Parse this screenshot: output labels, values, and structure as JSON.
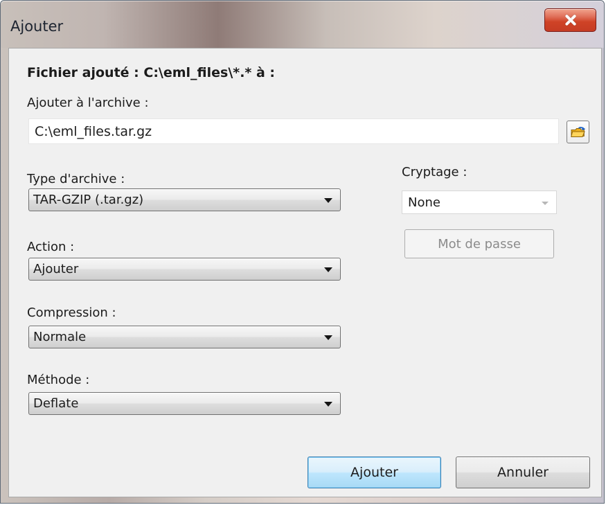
{
  "window": {
    "title": "Ajouter"
  },
  "form": {
    "file_added_label": "Fichier ajouté : C:\\eml_files\\*.* à :",
    "archive_label": "Ajouter à l'archive :",
    "archive_value": "C:\\eml_files.tar.gz",
    "archive_type_label": "Type d'archive :",
    "archive_type_value": "TAR-GZIP (.tar.gz)",
    "action_label": "Action :",
    "action_value": "Ajouter",
    "compression_label": "Compression :",
    "compression_value": "Normale",
    "method_label": "Méthode :",
    "method_value": "Deflate",
    "encryption_label": "Cryptage :",
    "encryption_value": "None",
    "password_button": "Mot de passe"
  },
  "buttons": {
    "ok": "Ajouter",
    "cancel": "Annuler"
  },
  "icons": {
    "close": "close-icon",
    "folder_browse": "folder-open-icon",
    "dropdown": "chevron-down-icon"
  },
  "colors": {
    "close_button": "#d04b31",
    "primary_button_border": "#3c7fb1"
  }
}
